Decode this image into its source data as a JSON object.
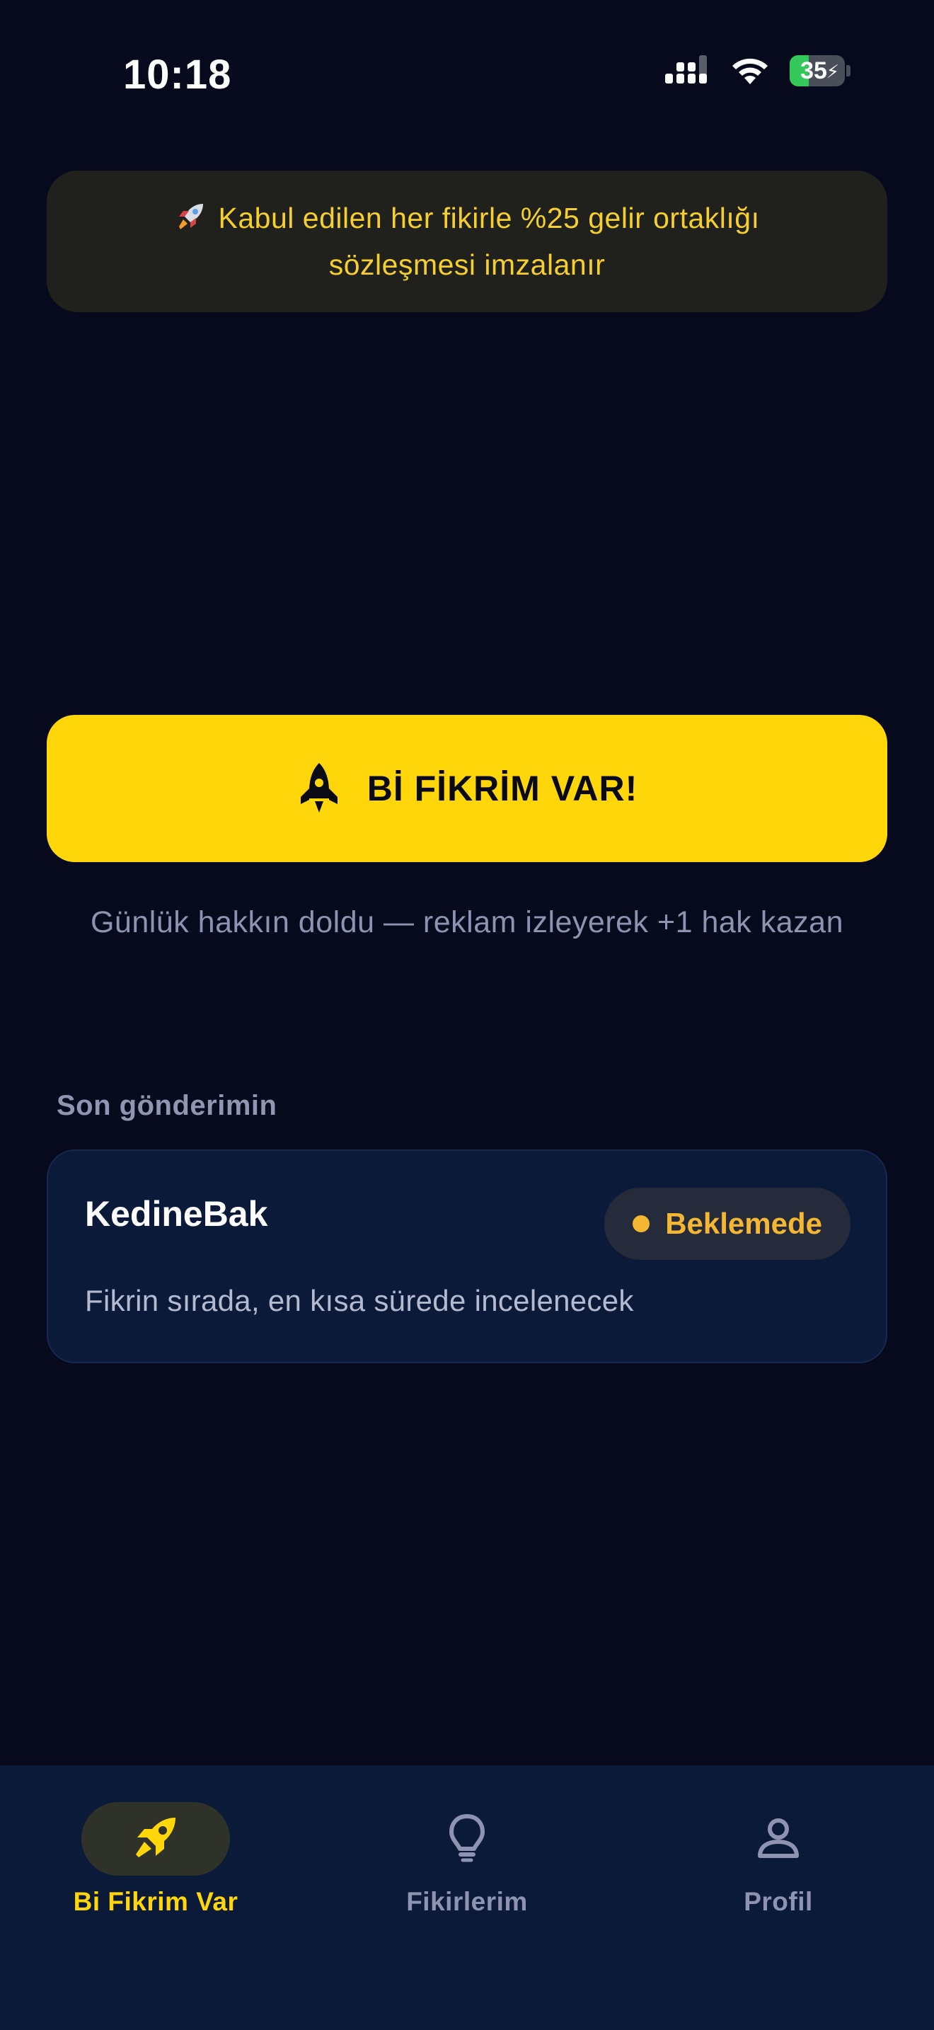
{
  "status_bar": {
    "time": "10:18",
    "battery_level": "35",
    "battery_fraction": 0.35,
    "battery_charging_icon": "bolt-icon"
  },
  "banner": {
    "icon": "rocket-icon",
    "text": "Kabul edilen her fikirle %25 gelir ortaklığı sözleşmesi imzalanır"
  },
  "cta": {
    "icon": "rocket-icon",
    "label": "Bİ FİKRİM VAR!"
  },
  "daily_limit_message": "Günlük hakkın doldu — reklam izleyerek +1 hak kazan",
  "recent": {
    "section_label": "Son gönderimin",
    "card": {
      "title": "KedineBak",
      "status": "Beklemede",
      "description": "Fikrin sırada, en kısa sürede incelenecek"
    }
  },
  "tabs": [
    {
      "label": "Bi Fikrim Var",
      "icon": "rocket-icon",
      "active": true
    },
    {
      "label": "Fikirlerim",
      "icon": "lightbulb-icon",
      "active": false
    },
    {
      "label": "Profil",
      "icon": "person-icon",
      "active": false
    }
  ],
  "colors": {
    "background": "#060a1c",
    "accent": "#ffd60a",
    "pending": "#f5b731",
    "card": "#0c1a3a",
    "battery": "#34c759"
  }
}
